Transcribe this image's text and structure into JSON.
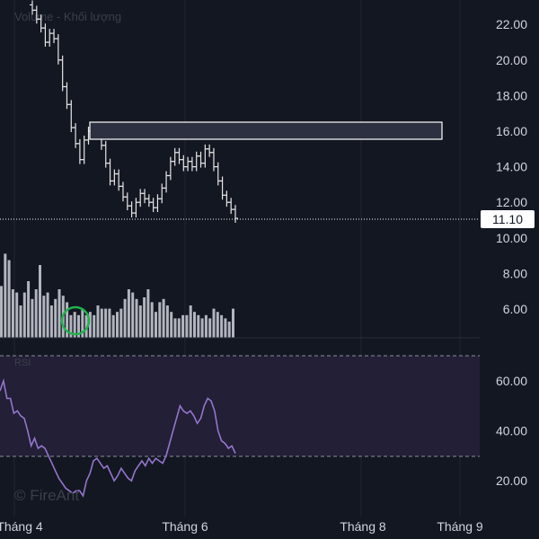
{
  "chart_data": {
    "type": "ohlc",
    "volume_label": "Volume - Khối lượng",
    "rsi_label": "RSI",
    "watermark": "© FireAnt",
    "price_axis_ticks": [
      "22.00",
      "20.00",
      "18.00",
      "16.00",
      "14.00",
      "12.00",
      "10.00",
      "8.00",
      "6.00"
    ],
    "rsi_axis_ticks": [
      "60.00",
      "40.00",
      "20.00"
    ],
    "x_axis_ticks": [
      "Tháng 4",
      "Tháng 6",
      "Tháng 8",
      "Tháng 9"
    ],
    "last_price": "11.10",
    "resistance_zone": [
      15.6,
      16.5
    ],
    "rsi_bands": [
      70,
      30
    ],
    "rsi_values": [
      56,
      60,
      53,
      53,
      47,
      48,
      46,
      45,
      40,
      34,
      37,
      33,
      34,
      33,
      30,
      27,
      24,
      21,
      19,
      17,
      16,
      15,
      16,
      16,
      14,
      20,
      23,
      28,
      29,
      27,
      25,
      26,
      23,
      20,
      22,
      25,
      23,
      21,
      20,
      24,
      26,
      28,
      26,
      29,
      27,
      29,
      28,
      27,
      30,
      35,
      40,
      45,
      50,
      48,
      47,
      48,
      46,
      43,
      45,
      50,
      53,
      52,
      48,
      40,
      36,
      35,
      33,
      34,
      31
    ],
    "close_prices": [
      22.8,
      22.3,
      21.8,
      21.0,
      21.5,
      21.2,
      20.0,
      18.5,
      17.5,
      16.2,
      15.3,
      14.4,
      15.5,
      16.0,
      16.2,
      15.8,
      15.2,
      14.2,
      13.2,
      13.6,
      12.9,
      12.3,
      11.8,
      11.4,
      12.0,
      12.5,
      12.2,
      12.0,
      11.7,
      12.2,
      12.8,
      13.5,
      14.3,
      14.8,
      14.4,
      14.0,
      14.3,
      14.0,
      14.6,
      14.2,
      15.0,
      14.8,
      14.0,
      13.2,
      12.4,
      12.0,
      11.6,
      11.1
    ],
    "volume_values": [
      32,
      52,
      48,
      30,
      28,
      20,
      28,
      35,
      24,
      30,
      45,
      26,
      28,
      20,
      24,
      30,
      26,
      22,
      14,
      16,
      14,
      18,
      14,
      16,
      14,
      20,
      18,
      18,
      18,
      14,
      16,
      18,
      24,
      30,
      28,
      24,
      20,
      25,
      30,
      22,
      16,
      22,
      24,
      20,
      16,
      12,
      12,
      14,
      14,
      20,
      16,
      14,
      12,
      14,
      12,
      18,
      16,
      14,
      12,
      10,
      18
    ]
  }
}
